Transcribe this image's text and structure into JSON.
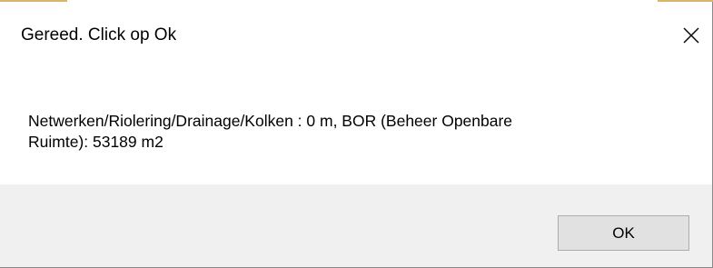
{
  "dialog": {
    "title": "Gereed. Click op Ok",
    "close_icon": "close-icon",
    "message_line1": "Netwerken/Riolering/Drainage/Kolken : 0 m, BOR (Beheer Openbare",
    "message_line2": "Ruimte): 53189 m2",
    "ok_label": "OK"
  },
  "colors": {
    "dialog_background": "#ffffff",
    "footer_background": "#f0f0f0",
    "button_background": "#e1e1e1",
    "button_border": "#adadad",
    "accent": "#d9b46a"
  }
}
